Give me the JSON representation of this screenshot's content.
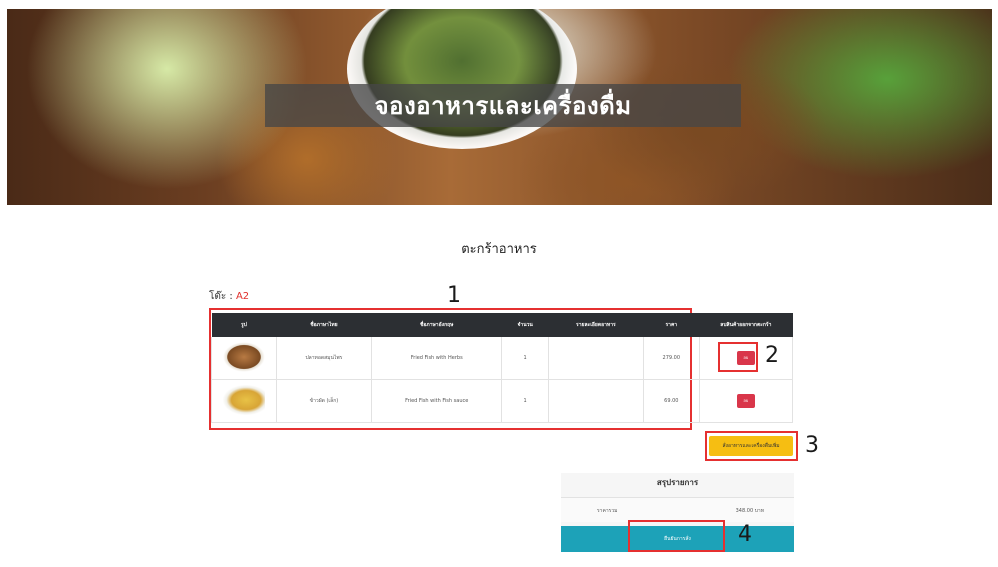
{
  "banner": {
    "title": "จองอาหารและเครื่องดื่ม"
  },
  "cart": {
    "title": "ตะกร้าอาหาร",
    "table_label": "โต๊ะ : ",
    "table_value": "A2",
    "columns": [
      "รูป",
      "ชื่อภาษาไทย",
      "ชื่อภาษาอังกฤษ",
      "จำนวน",
      "รายละเอียดอาหาร",
      "ราคา",
      "ลบสินค้าออกจากตะกร้า"
    ],
    "rows": [
      {
        "image": "fried-fish-herbs-photo",
        "name_th": "ปลาทอดสมุนไพร",
        "name_en": "Fried Fish with Herbs",
        "qty": "1",
        "detail": "",
        "price": "279.00",
        "delete_label": "ลบ"
      },
      {
        "image": "fried-fish-sauce-photo",
        "name_th": "ข้าวผัด (เล็ก)",
        "name_en": "Fried Fish with Fish sauce",
        "qty": "1",
        "detail": "",
        "price": "69.00",
        "delete_label": "ลบ"
      }
    ],
    "order_more_label": "สั่งอาหารและเครื่องดื่มเพิ่ม"
  },
  "summary": {
    "title": "สรุปรายการ",
    "total_label": "ราคารวม",
    "total_value": "348.00 บาท",
    "confirm_label": "ยืนยันการสั่ง"
  },
  "annotations": [
    "1",
    "2",
    "3",
    "4"
  ],
  "colors": {
    "header_bg": "#2c2f33",
    "delete_btn": "#d9364a",
    "order_more_btn": "#f6be12",
    "confirm_btn": "#1da2b8",
    "annotation_red": "#e53030",
    "table_value": "#e0302c"
  }
}
